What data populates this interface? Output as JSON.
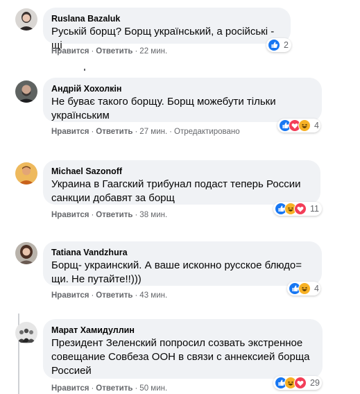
{
  "colors": {
    "bubble": "#f0f2f5",
    "meta": "#65676b",
    "like": "#1877f2",
    "love": "#f33e58",
    "haha": "#f7b125"
  },
  "comments": [
    {
      "author": "Ruslana Bazaluk",
      "lines": [
        "Руській борщ? Борщ український, а російські - щі"
      ],
      "like": "Нравится",
      "reply": "Ответить",
      "time": "22 мин.",
      "edited": "",
      "reactions": [
        "like-icon"
      ],
      "count": "2",
      "avatar": "woman-light-icon"
    },
    {
      "author": "Андрій Хохолкін",
      "lines": [
        "Не буває такого борщу. Борщ можебути тільки",
        "українським"
      ],
      "like": "Нравится",
      "reply": "Ответить",
      "time": "27 мин.",
      "edited": "Отредактировано",
      "reactions": [
        "like-icon",
        "love-icon",
        "haha-icon"
      ],
      "count": "4",
      "avatar": "man-bearded-icon"
    },
    {
      "author": "Michael Sazonoff",
      "lines": [
        "Украина в Гаагский трибунал подаст теперь России",
        "санкции добавят за борщ"
      ],
      "like": "Нравится",
      "reply": "Ответить",
      "time": "38 мин.",
      "edited": "",
      "reactions": [
        "like-icon",
        "haha-icon",
        "love-icon"
      ],
      "count": "11",
      "avatar": "man-orange-icon"
    },
    {
      "author": "Tatiana Vandzhura",
      "lines": [
        "Борщ- украинский. А ваше исконно русское блюдо=",
        "щи. Не путайте!!)))"
      ],
      "like": "Нравится",
      "reply": "Ответить",
      "time": "43 мин.",
      "edited": "",
      "reactions": [
        "like-icon",
        "haha-icon"
      ],
      "count": "4",
      "avatar": "woman-dark-icon"
    },
    {
      "author": "Марат Хамидуллин",
      "lines": [
        "Президент Зеленский попросил созвать экстренное",
        "совещание Совбеза ООН в связи с аннексией борща",
        "Россией"
      ],
      "like": "Нравится",
      "reply": "Ответить",
      "time": "50 мин.",
      "edited": "",
      "reactions": [
        "like-icon",
        "haha-icon",
        "love-icon"
      ],
      "count": "29",
      "avatar": "group-photo-icon"
    }
  ]
}
